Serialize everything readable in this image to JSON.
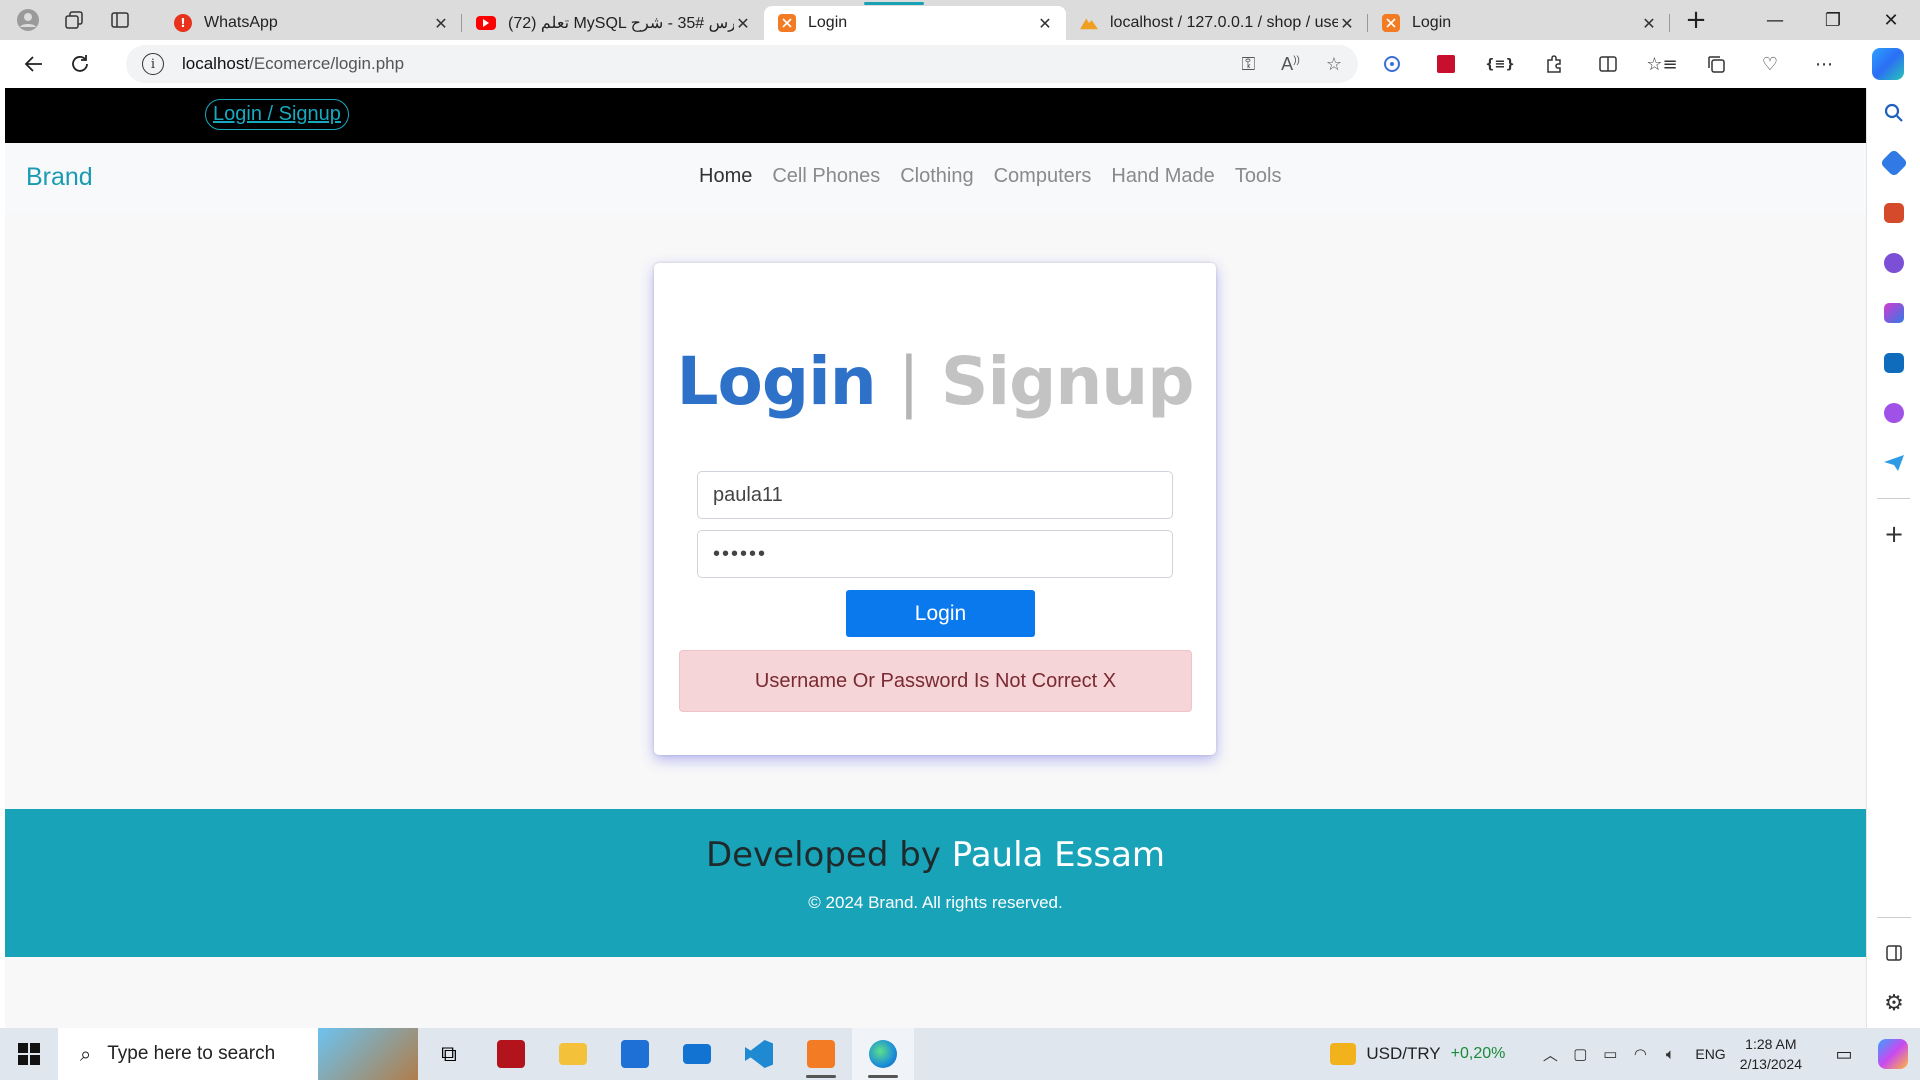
{
  "browser": {
    "tabs": [
      {
        "title": "WhatsApp",
        "favicon": "whatsapp-icon",
        "color": "#e8321c",
        "active": false
      },
      {
        "title": "(72) تعلم MySQL درس #35 - شرح",
        "favicon": "youtube-icon",
        "color": "#ff0000",
        "active": false
      },
      {
        "title": "Login",
        "favicon": "xampp-icon",
        "color": "#f37b23",
        "active": true
      },
      {
        "title": "localhost / 127.0.0.1 / shop / use",
        "favicon": "phpmyadmin-icon",
        "color": "#f0a020",
        "active": false
      },
      {
        "title": "Login",
        "favicon": "xampp-icon",
        "color": "#f37b23",
        "active": false
      }
    ],
    "url_host": "localhost",
    "url_path": "/Ecomerce/login.php"
  },
  "site": {
    "topbar_link": "Login / Signup",
    "brand": "Brand",
    "nav": [
      "Home",
      "Cell Phones",
      "Clothing",
      "Computers",
      "Hand Made",
      "Tools"
    ],
    "nav_active": "Home"
  },
  "login": {
    "heading_login": "Login",
    "heading_sep": "|",
    "heading_signup": "Signup",
    "username_value": "paula11",
    "password_value": "••••••",
    "button": "Login",
    "error": "Username Or Password Is Not Correct X"
  },
  "footer": {
    "dev_prefix": "Developed by",
    "dev_name": "Paula Essam",
    "copyright": "© 2024 Brand. All rights reserved."
  },
  "taskbar": {
    "search_placeholder": "Type here to search",
    "widget_label": "USD/TRY",
    "widget_change": "+0,20%",
    "language": "ENG",
    "time": "1:28 AM",
    "date": "2/13/2024"
  },
  "colors": {
    "brand": "#1a9bb1",
    "footer": "#18a3b9",
    "login_button": "#0b79ee",
    "error_bg": "#f6d5d8"
  }
}
